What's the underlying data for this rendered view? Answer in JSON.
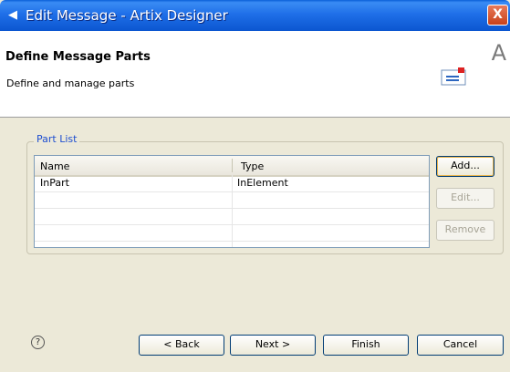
{
  "window": {
    "title": "Edit Message - Artix Designer",
    "close_label": "X"
  },
  "header": {
    "title": "Define Message Parts",
    "description": "Define and manage parts",
    "corner_letter": "A"
  },
  "part_list": {
    "label": "Part List",
    "columns": [
      "Name",
      "Type"
    ],
    "rows": [
      {
        "name": "InPart",
        "type": "InElement"
      }
    ]
  },
  "side_buttons": {
    "add": "Add...",
    "edit": "Edit...",
    "remove": "Remove"
  },
  "footer": {
    "help": "?",
    "back": "< Back",
    "next": "Next >",
    "finish": "Finish",
    "cancel": "Cancel"
  },
  "colors": {
    "title_bar": "#0b56d0",
    "close": "#c8411a",
    "group_label": "#1f4fd0"
  }
}
